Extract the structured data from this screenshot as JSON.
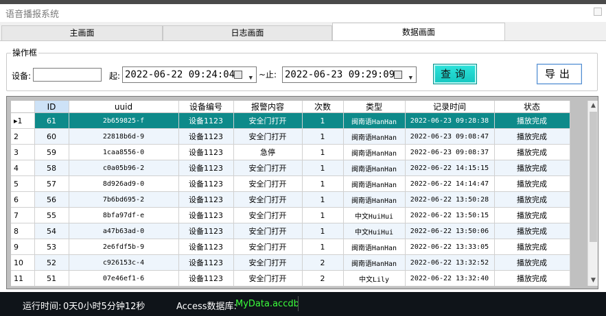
{
  "window": {
    "title": "语音播报系统"
  },
  "tabs": [
    {
      "label": "主画面"
    },
    {
      "label": "日志画面"
    },
    {
      "label": "数据画面"
    }
  ],
  "filter": {
    "group_label": "操作框",
    "device_label": "设备:",
    "device_value": "",
    "start_label": "起:",
    "start_value": "2022-06-22 09:24:04",
    "end_label": "~止:",
    "end_value": "2022-06-23 09:29:09",
    "query_label": "查询",
    "export_label": "导出"
  },
  "grid": {
    "columns": [
      "ID",
      "uuid",
      "设备编号",
      "报警内容",
      "次数",
      "类型",
      "记录时间",
      "状态"
    ],
    "selected_marker": "▸1",
    "rows": [
      {
        "n": "1",
        "id": "61",
        "uuid": "2b659825-f",
        "device": "设备1123",
        "alarm": "安全门打开",
        "count": "1",
        "type": "闽南语HanHan",
        "time": "2022-06-23 09:28:38",
        "status": "播放完成"
      },
      {
        "n": "2",
        "id": "60",
        "uuid": "22818b6d-9",
        "device": "设备1123",
        "alarm": "安全门打开",
        "count": "1",
        "type": "闽南语HanHan",
        "time": "2022-06-23 09:08:47",
        "status": "播放完成"
      },
      {
        "n": "3",
        "id": "59",
        "uuid": "1caa8556-0",
        "device": "设备1123",
        "alarm": "急停",
        "count": "1",
        "type": "闽南语HanHan",
        "time": "2022-06-23 09:08:37",
        "status": "播放完成"
      },
      {
        "n": "4",
        "id": "58",
        "uuid": "c0a05b96-2",
        "device": "设备1123",
        "alarm": "安全门打开",
        "count": "1",
        "type": "闽南语HanHan",
        "time": "2022-06-22 14:15:15",
        "status": "播放完成"
      },
      {
        "n": "5",
        "id": "57",
        "uuid": "8d926ad9-0",
        "device": "设备1123",
        "alarm": "安全门打开",
        "count": "1",
        "type": "闽南语HanHan",
        "time": "2022-06-22 14:14:47",
        "status": "播放完成"
      },
      {
        "n": "6",
        "id": "56",
        "uuid": "7b6bd695-2",
        "device": "设备1123",
        "alarm": "安全门打开",
        "count": "1",
        "type": "闽南语HanHan",
        "time": "2022-06-22 13:50:28",
        "status": "播放完成"
      },
      {
        "n": "7",
        "id": "55",
        "uuid": "8bfa97df-e",
        "device": "设备1123",
        "alarm": "安全门打开",
        "count": "1",
        "type": "中文HuiHui",
        "time": "2022-06-22 13:50:15",
        "status": "播放完成"
      },
      {
        "n": "8",
        "id": "54",
        "uuid": "a47b63ad-0",
        "device": "设备1123",
        "alarm": "安全门打开",
        "count": "1",
        "type": "中文HuiHui",
        "time": "2022-06-22 13:50:06",
        "status": "播放完成"
      },
      {
        "n": "9",
        "id": "53",
        "uuid": "2e6fdf5b-9",
        "device": "设备1123",
        "alarm": "安全门打开",
        "count": "1",
        "type": "闽南语HanHan",
        "time": "2022-06-22 13:33:05",
        "status": "播放完成"
      },
      {
        "n": "10",
        "id": "52",
        "uuid": "c926153c-4",
        "device": "设备1123",
        "alarm": "安全门打开",
        "count": "2",
        "type": "闽南语HanHan",
        "time": "2022-06-22 13:32:52",
        "status": "播放完成"
      },
      {
        "n": "11",
        "id": "51",
        "uuid": "07e46ef1-6",
        "device": "设备1123",
        "alarm": "安全门打开",
        "count": "2",
        "type": "中文Lily",
        "time": "2022-06-22 13:32:40",
        "status": "播放完成"
      }
    ]
  },
  "status": {
    "runtime_label": "运行时间:",
    "runtime_value": "0天0小时5分钟12秒",
    "db_label": "Access数据库:",
    "db_value": "MyData.accdb"
  },
  "colors": {
    "selected_row": "#0e8a8a",
    "query_button": "#1fd5ce",
    "statusbar_bg": "#0f1419",
    "db_text": "#3bff3b"
  }
}
